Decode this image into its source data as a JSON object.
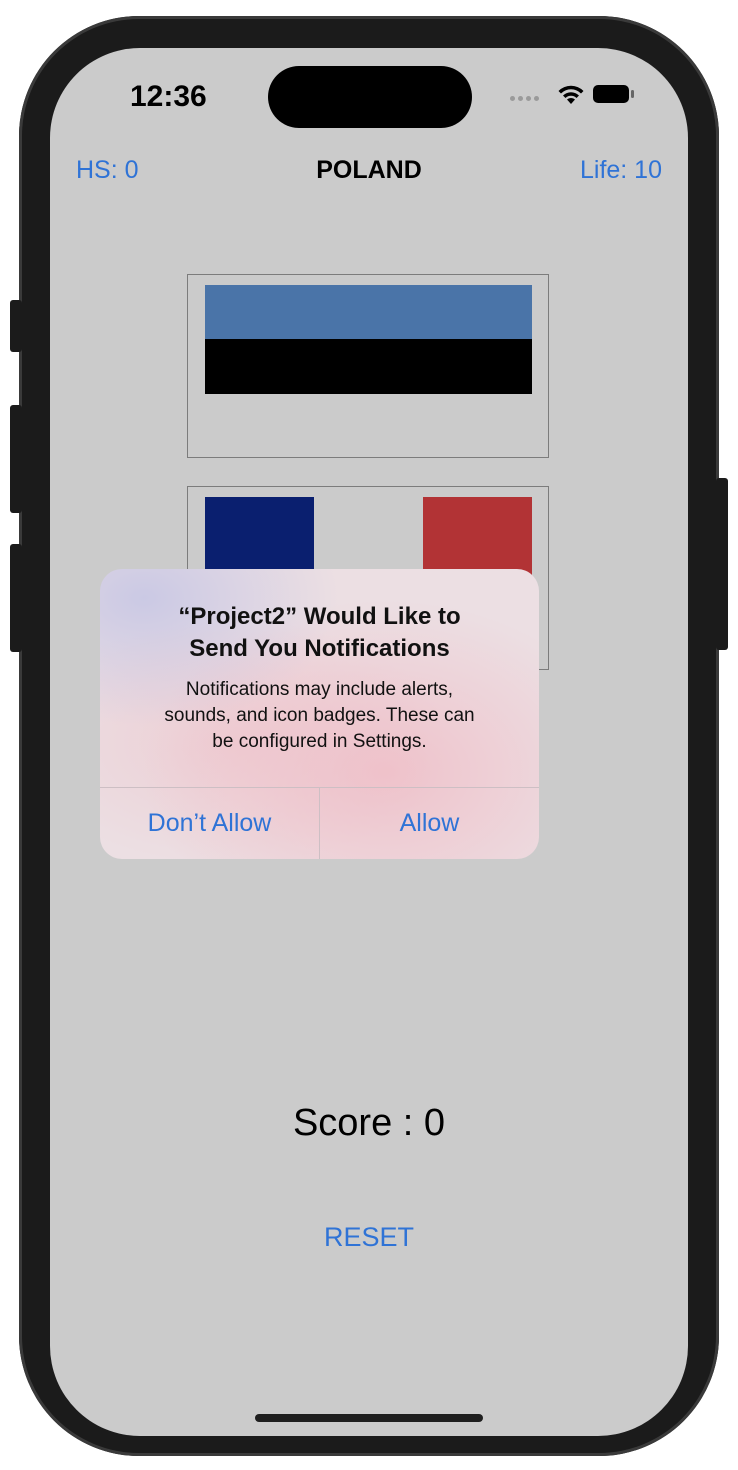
{
  "status_bar": {
    "time": "12:36",
    "signal_icon": "signal-dots-icon",
    "wifi_icon": "wifi-icon",
    "battery_icon": "battery-icon"
  },
  "header": {
    "high_score": "HS: 0",
    "country": "POLAND",
    "life": "Life: 10"
  },
  "flags": [
    {
      "name": "flag-option-1",
      "stripes": [
        "#4a74a8",
        "#000000",
        "#cbcbcb"
      ]
    },
    {
      "name": "flag-option-2",
      "stripes": [
        "#0a1f6f",
        "#cbcbcb",
        "#b23335"
      ]
    }
  ],
  "score": "Score : 0",
  "reset_label": "RESET",
  "alert": {
    "title_line1": "“Project2” Would Like to",
    "title_line2": "Send You Notifications",
    "message_line1": "Notifications may include alerts,",
    "message_line2": "sounds, and icon badges. These can",
    "message_line3": "be configured in Settings.",
    "deny_label": "Don’t Allow",
    "allow_label": "Allow"
  },
  "colors": {
    "accent": "#2f73d6",
    "background": "#cbcbcb"
  }
}
